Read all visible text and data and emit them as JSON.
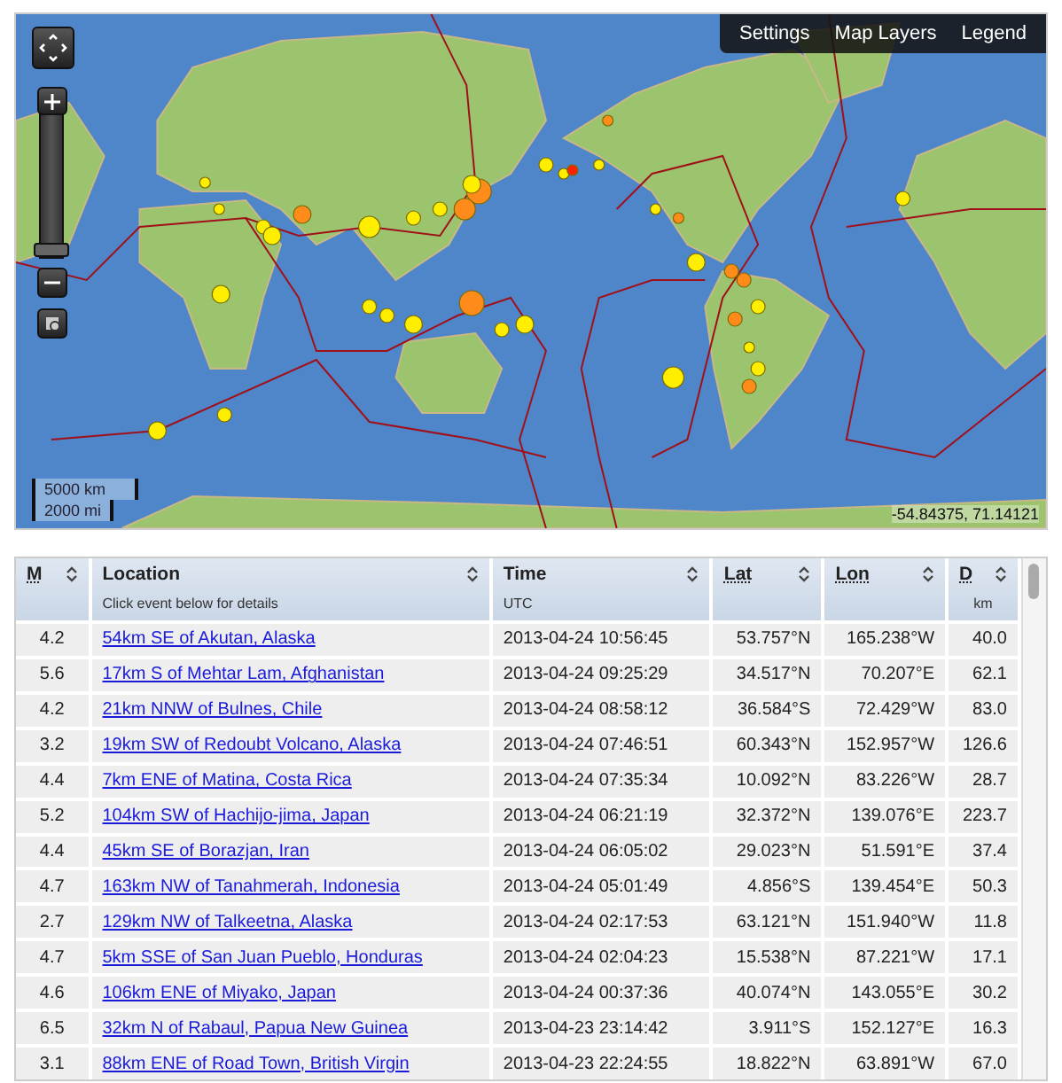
{
  "map": {
    "toolbar": [
      {
        "label": "Settings"
      },
      {
        "label": "Map Layers"
      },
      {
        "label": "Legend"
      }
    ],
    "scale": {
      "km": "5000 km",
      "mi": "2000 mi"
    },
    "coordinates": "-54.84375, 71.14121",
    "zoom": {
      "level": 0.05
    }
  },
  "table": {
    "columns": [
      {
        "label": "M",
        "abbr": true
      },
      {
        "label": "Location",
        "sublabel": "Click event below for details",
        "abbr": false
      },
      {
        "label": "Time",
        "sublabel": "UTC",
        "abbr": false
      },
      {
        "label": "Lat",
        "abbr": true
      },
      {
        "label": "Lon",
        "abbr": true
      },
      {
        "label": "D",
        "abbr": true,
        "sublabel": "km"
      }
    ],
    "rows": [
      {
        "magnitude": "4.2",
        "location": "54km SE of Akutan, Alaska",
        "time": "2013-04-24 10:56:45",
        "lat": "53.757°N",
        "lon": "165.238°W",
        "depth": "40.0"
      },
      {
        "magnitude": "5.6",
        "location": "17km S of Mehtar Lam, Afghanistan",
        "time": "2013-04-24 09:25:29",
        "lat": "34.517°N",
        "lon": "70.207°E",
        "depth": "62.1"
      },
      {
        "magnitude": "4.2",
        "location": "21km NNW of Bulnes, Chile",
        "time": "2013-04-24 08:58:12",
        "lat": "36.584°S",
        "lon": "72.429°W",
        "depth": "83.0"
      },
      {
        "magnitude": "3.2",
        "location": "19km SW of Redoubt Volcano, Alaska",
        "time": "2013-04-24 07:46:51",
        "lat": "60.343°N",
        "lon": "152.957°W",
        "depth": "126.6"
      },
      {
        "magnitude": "4.4",
        "location": "7km ENE of Matina, Costa Rica",
        "time": "2013-04-24 07:35:34",
        "lat": "10.092°N",
        "lon": "83.226°W",
        "depth": "28.7"
      },
      {
        "magnitude": "5.2",
        "location": "104km SW of Hachijo-jima, Japan",
        "time": "2013-04-24 06:21:19",
        "lat": "32.372°N",
        "lon": "139.076°E",
        "depth": "223.7"
      },
      {
        "magnitude": "4.4",
        "location": "45km SE of Borazjan, Iran",
        "time": "2013-04-24 06:05:02",
        "lat": "29.023°N",
        "lon": "51.591°E",
        "depth": "37.4"
      },
      {
        "magnitude": "4.7",
        "location": "163km NW of Tanahmerah, Indonesia",
        "time": "2013-04-24 05:01:49",
        "lat": "4.856°S",
        "lon": "139.454°E",
        "depth": "50.3"
      },
      {
        "magnitude": "2.7",
        "location": "129km NW of Talkeetna, Alaska",
        "time": "2013-04-24 02:17:53",
        "lat": "63.121°N",
        "lon": "151.940°W",
        "depth": "11.8"
      },
      {
        "magnitude": "4.7",
        "location": "5km SSE of San Juan Pueblo, Honduras",
        "time": "2013-04-24 02:04:23",
        "lat": "15.538°N",
        "lon": "87.221°W",
        "depth": "17.1"
      },
      {
        "magnitude": "4.6",
        "location": "106km ENE of Miyako, Japan",
        "time": "2013-04-24 00:37:36",
        "lat": "40.074°N",
        "lon": "143.055°E",
        "depth": "30.2"
      },
      {
        "magnitude": "6.5",
        "location": "32km N of Rabaul, Papua New Guinea",
        "time": "2013-04-23 23:14:42",
        "lat": "3.911°S",
        "lon": "152.127°E",
        "depth": "16.3"
      },
      {
        "magnitude": "3.1",
        "location": "88km ENE of Road Town, British Virgin",
        "time": "2013-04-23 22:24:55",
        "lat": "18.822°N",
        "lon": "63.891°W",
        "depth": "67.0"
      }
    ]
  }
}
